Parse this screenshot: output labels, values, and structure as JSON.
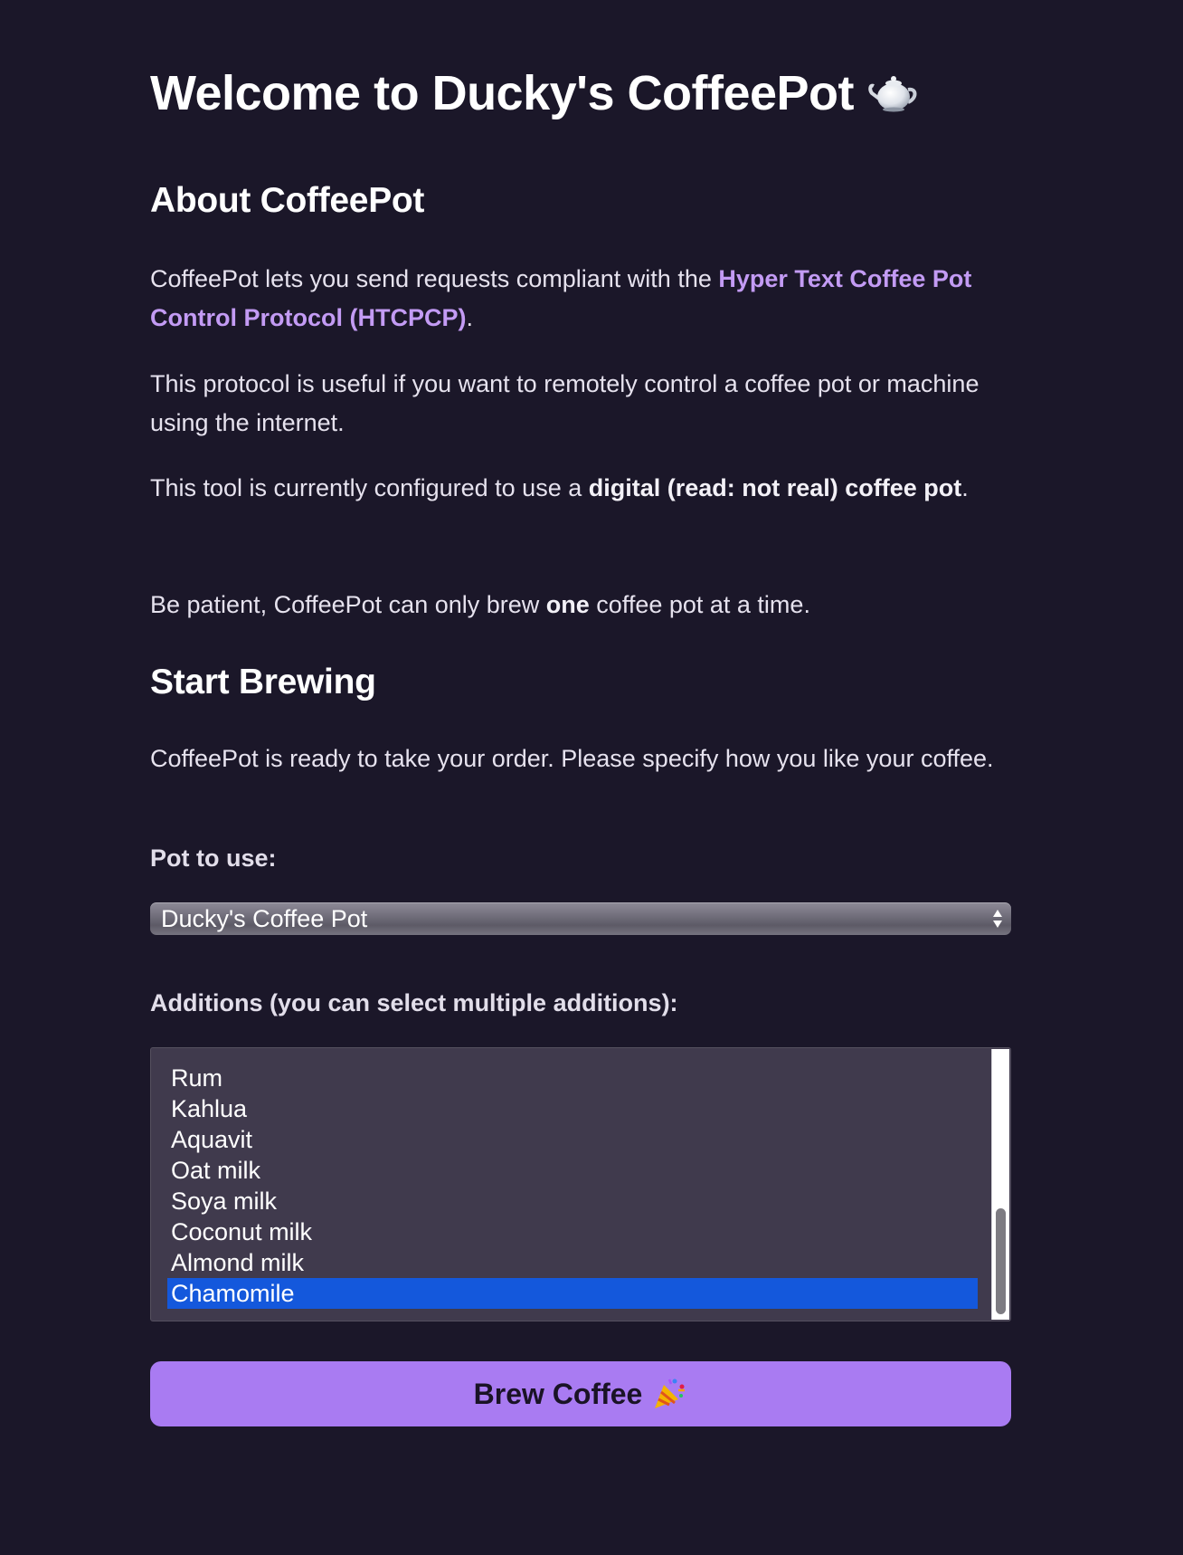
{
  "header": {
    "title": "Welcome to Ducky's CoffeePot",
    "title_icon": "teapot-icon"
  },
  "about": {
    "heading": "About CoffeePot",
    "para1_prefix": "CoffeePot lets you send requests compliant with the ",
    "para1_link": "Hyper Text Coffee Pot Control Protocol (HTCPCP)",
    "para1_suffix": ".",
    "para2": "This protocol is useful if you want to remotely control a coffee pot or machine using the internet.",
    "para3_prefix": "This tool is currently configured to use a ",
    "para3_bold": "digital (read: not real) coffee pot",
    "para3_suffix": ".",
    "para4_prefix": "Be patient, CoffeePot can only brew ",
    "para4_bold": "one",
    "para4_suffix": " coffee pot at a time."
  },
  "brewing": {
    "heading": "Start Brewing",
    "intro": "CoffeePot is ready to take your order. Please specify how you like your coffee.",
    "pot_label": "Pot to use:",
    "pot_selected": "Ducky's Coffee Pot",
    "additions_label": "Additions (you can select multiple additions):",
    "additions": [
      "Rum",
      "Kahlua",
      "Aquavit",
      "Oat milk",
      "Soya milk",
      "Coconut milk",
      "Almond milk",
      "Chamomile"
    ],
    "selected_addition": "Chamomile",
    "brew_button": "Brew Coffee",
    "brew_button_icon": "party-popper-icon"
  },
  "colors": {
    "background": "#1b1729",
    "link": "#c39bf4",
    "button": "#a97bf2",
    "selection": "#1458dc"
  }
}
